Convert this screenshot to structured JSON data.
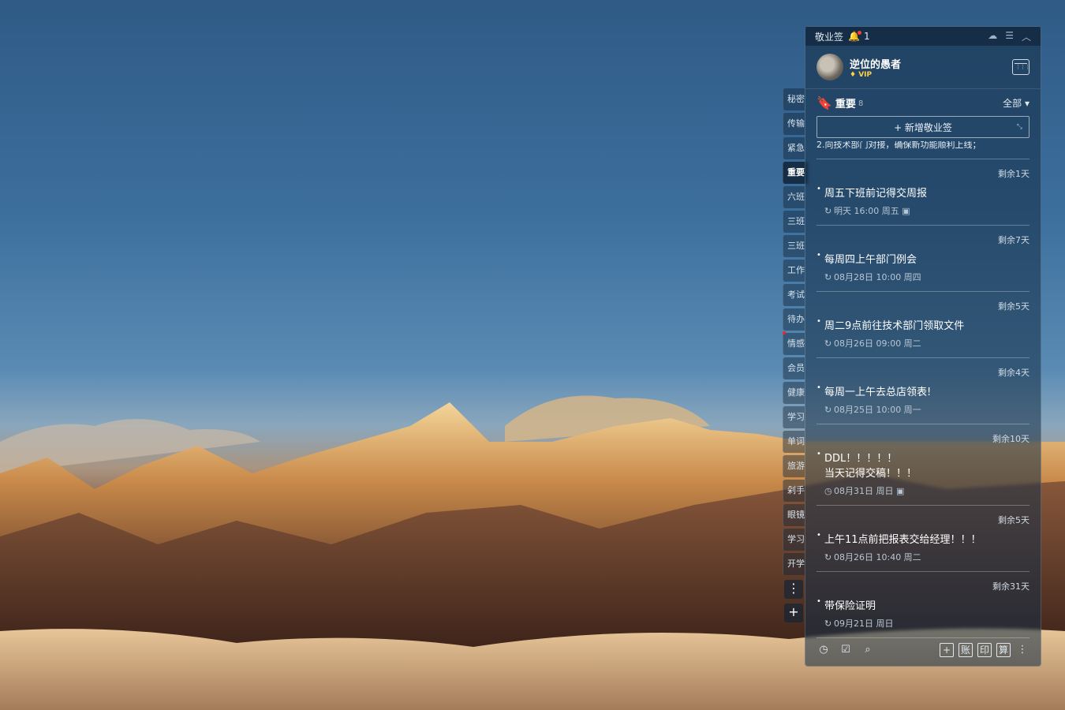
{
  "app": {
    "title": "敬业签",
    "notification_count": "1",
    "user": {
      "name": "逆位的愚者",
      "badge": "VIP"
    }
  },
  "group": {
    "name": "重要",
    "count": "8",
    "filter": "全部",
    "new_note_label": "+ 新增敬业签",
    "cut_text": "2.向技术部门对接，确保新功能顺利上线；"
  },
  "side_tabs": [
    "秘密",
    "传输",
    "紧急",
    "重要",
    "六班",
    "三班",
    "三班",
    "工作",
    "考试",
    "待办",
    "情感",
    "会员",
    "健康",
    "学习",
    "单词",
    "旅游",
    "剁手",
    "眼镜",
    "学习",
    "开学"
  ],
  "items": [
    {
      "remain": "剩余1天",
      "title": "周五下班前记得交周报",
      "meta": "明天 16:00 周五"
    },
    {
      "remain": "剩余7天",
      "title": "每周四上午部门例会",
      "meta": "08月28日 10:00 周四"
    },
    {
      "remain": "剩余5天",
      "title": "周二9点前往技术部门领取文件",
      "meta": "08月26日 09:00 周二"
    },
    {
      "remain": "剩余4天",
      "title": "每周一上午去总店领表!",
      "meta": "08月25日 10:00 周一"
    },
    {
      "remain": "剩余10天",
      "title": "DDL！！！！！",
      "title2": "当天记得交稿！！！",
      "meta": "08月31日 周日"
    },
    {
      "remain": "剩余5天",
      "title": "上午11点前把报表交给经理！！！",
      "meta": "08月26日 10:40 周二"
    },
    {
      "remain": "剩余31天",
      "title": "带保险证明",
      "meta": "09月21日 周日"
    }
  ],
  "bottom": {
    "btn_account": "账",
    "btn_print": "印",
    "btn_calc": "算"
  },
  "icons": [
    "bell-icon",
    "cloud-icon",
    "menu-icon",
    "collapse-icon",
    "calendar-icon",
    "bookmark-icon",
    "repeat-icon",
    "clock-icon",
    "checklist-icon",
    "search-icon",
    "add-icon",
    "more-icon"
  ]
}
